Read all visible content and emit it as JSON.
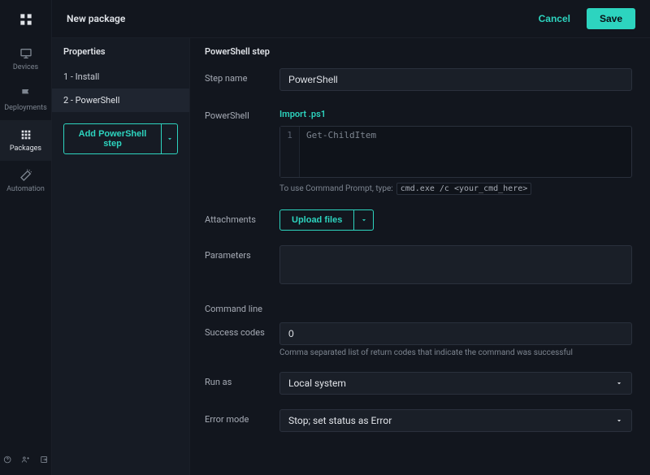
{
  "nav": {
    "items": [
      {
        "label": "Devices"
      },
      {
        "label": "Deployments"
      },
      {
        "label": "Packages"
      },
      {
        "label": "Automation"
      }
    ]
  },
  "header": {
    "title": "New package",
    "cancel": "Cancel",
    "save": "Save"
  },
  "steps": {
    "heading": "Properties",
    "items": [
      {
        "label": "1 - Install"
      },
      {
        "label": "2 - PowerShell"
      }
    ],
    "add_label": "Add PowerShell step"
  },
  "form": {
    "title": "PowerShell step",
    "step_name": {
      "label": "Step name",
      "value": "PowerShell"
    },
    "powershell": {
      "label": "PowerShell",
      "import_link": "Import .ps1",
      "line_no": "1",
      "code_placeholder": "Get-ChildItem",
      "hint_prefix": "To use Command Prompt, type:",
      "hint_code": "cmd.exe /c <your_cmd_here>"
    },
    "attachments": {
      "label": "Attachments",
      "upload": "Upload files"
    },
    "parameters": {
      "label": "Parameters"
    },
    "command_line": {
      "label": "Command line"
    },
    "success_codes": {
      "label": "Success codes",
      "value": "0",
      "helper": "Comma separated list of return codes that indicate the command was successful"
    },
    "run_as": {
      "label": "Run as",
      "value": "Local system"
    },
    "error_mode": {
      "label": "Error mode",
      "value": "Stop; set status as Error"
    }
  }
}
